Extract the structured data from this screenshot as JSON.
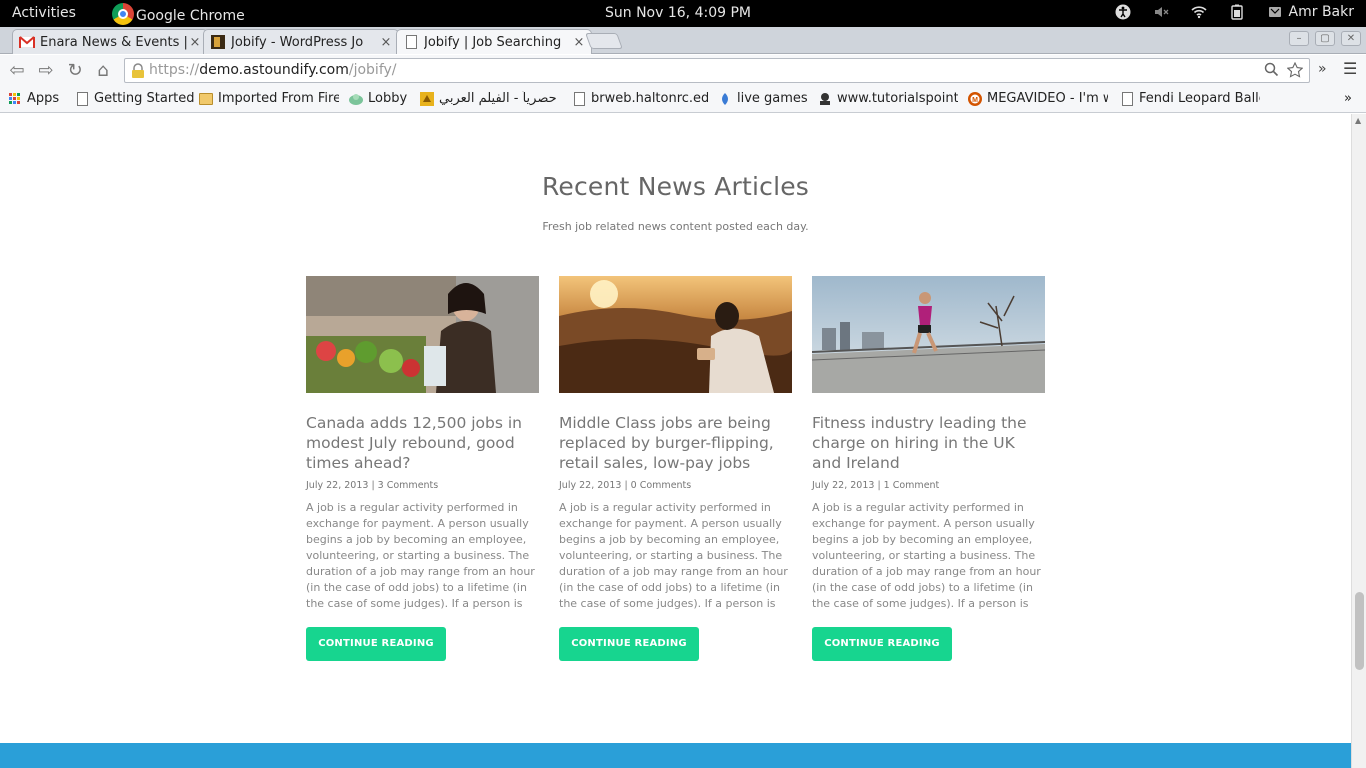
{
  "system_bar": {
    "activities": "Activities",
    "app_name": "Google Chrome",
    "clock": "Sun Nov 16,  4:09 PM",
    "user": "Amr Bakr"
  },
  "tabs": [
    {
      "title": "Enara News & Events |",
      "close": "×"
    },
    {
      "title": "Jobify - WordPress Jo",
      "close": "×"
    },
    {
      "title": "Jobify | Job Searching",
      "close": "×"
    }
  ],
  "toolbar": {
    "url_scheme": "https://",
    "url_host": "demo.astoundify.com",
    "url_path": "/jobify/",
    "overflow": "»"
  },
  "bookmarks": {
    "items": [
      {
        "label": "Apps",
        "icon": "apps-grid-icon"
      },
      {
        "label": "Getting Started",
        "icon": "page-icon"
      },
      {
        "label": "Imported From Fire",
        "icon": "folder-icon"
      },
      {
        "label": "Lobby",
        "icon": "lobby-icon"
      },
      {
        "label": "حصرياً - الفيلم العربي",
        "icon": "film-icon"
      },
      {
        "label": "brweb.haltonrc.edu",
        "icon": "page-icon"
      },
      {
        "label": "live games",
        "icon": "games-icon"
      },
      {
        "label": "www.tutorialspoint",
        "icon": "tutorialspoint-icon"
      },
      {
        "label": "MEGAVIDEO - I'm w",
        "icon": "megavideo-icon"
      },
      {
        "label": "Fendi Leopard Balle",
        "icon": "page-icon"
      }
    ],
    "overflow": "»"
  },
  "section": {
    "title": "Recent News Articles",
    "subtitle": "Fresh job related news content posted each day."
  },
  "articles": [
    {
      "title": "Canada adds 12,500 jobs in modest July rebound, good times ahead?",
      "date": "July 22, 2013",
      "comments": "3 Comments",
      "excerpt": "A job is a regular activity performed in exchange for payment. A person usually begins a job by becoming an employee, volunteering, or starting a business. The duration of a job may range from an hour (in the case of odd jobs) to a lifetime (in the case of some judges). If a person is",
      "button": "CONTINUE READING"
    },
    {
      "title": "Middle Class jobs are being replaced by burger-flipping, retail sales, low-pay jobs",
      "date": "July 22, 2013",
      "comments": "0 Comments",
      "excerpt": "A job is a regular activity performed in exchange for payment. A person usually begins a job by becoming an employee, volunteering, or starting a business. The duration of a job may range from an hour (in the case of odd jobs) to a lifetime (in the case of some judges). If a person is",
      "button": "CONTINUE READING"
    },
    {
      "title": "Fitness industry leading the charge on hiring in the UK and Ireland",
      "date": "July 22, 2013",
      "comments": "1 Comment",
      "excerpt": "A job is a regular activity performed in exchange for payment. A person usually begins a job by becoming an employee, volunteering, or starting a business. The duration of a job may range from an hour (in the case of odd jobs) to a lifetime (in the case of some judges). If a person is",
      "button": "CONTINUE READING"
    }
  ],
  "colors": {
    "button": "#17d58f",
    "footer": "#2a9fd8"
  }
}
